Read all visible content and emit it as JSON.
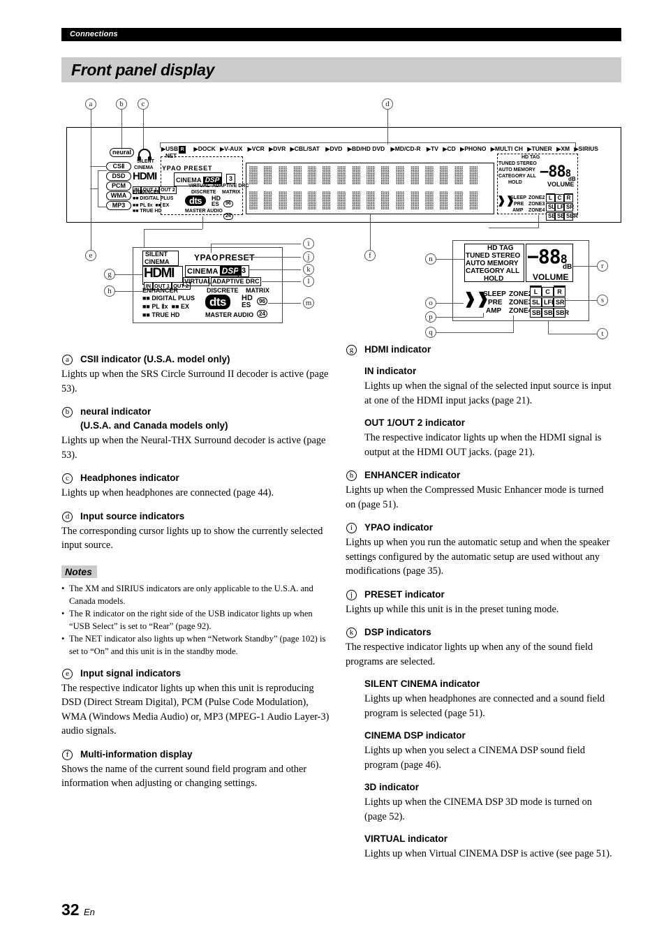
{
  "header": {
    "section": "Connections",
    "title": "Front panel display"
  },
  "footer": {
    "page_number": "32",
    "lang": "En"
  },
  "diagram": {
    "callouts_top": [
      "a",
      "b",
      "c",
      "d"
    ],
    "callouts_left": [
      "e",
      "g",
      "h"
    ],
    "callouts_mid": [
      "f"
    ],
    "callouts_detail_left": [
      "i",
      "j",
      "k",
      "l",
      "m"
    ],
    "callouts_detail_right": [
      "n",
      "o",
      "p",
      "q",
      "r",
      "s",
      "t"
    ],
    "neural_label": "neural",
    "signal_labels": [
      "CSⅡ",
      "DSD",
      "PCM",
      "WMA",
      "MP3"
    ],
    "input_sources_row1": [
      "USB",
      "DOCK",
      "V-AUX",
      "VCR",
      "DVR",
      "CBL/SAT",
      "DVD",
      "BD/HD DVD",
      "MD/CD-R",
      "TV",
      "CD",
      "PHONO",
      "MULTI CH",
      "TUNER",
      "XM",
      "SIRIUS"
    ],
    "usb_rear_badge": "R",
    "net_label": "NET",
    "silent": "SILENT",
    "cinema": "CINEMA",
    "hdmi": "HDMI",
    "hdmi_in": "IN",
    "hdmi_out1": "OUT 1",
    "hdmi_out2": "OUT 2",
    "ypao": "YPAO",
    "preset": "PRESET",
    "preset_num": "3",
    "cinema_dsp_a": "CINEMA",
    "cinema_dsp_b": "DSP",
    "dsp_3d": "3",
    "virtual": "VIRTUAL",
    "adaptive_drc": "ADAPTIVE DRC",
    "enhancer": "ENHANCER",
    "discrete": "DISCRETE",
    "matrix": "MATRIX",
    "dd_digital_plus": "DIGITAL PLUS",
    "dd_pllx": "PL Ⅱx",
    "dd_ex": "EX",
    "dd_true_hd": "TRUE HD",
    "dts": "dts",
    "master_audio": "MASTER AUDIO",
    "hd_es": "HD",
    "es": "ES",
    "num_96": "96",
    "num_24": "24",
    "tuner_block": [
      "HD  TAG",
      "TUNED STEREO",
      "AUTO MEMORY",
      "CATEGORY ALL",
      "HOLD"
    ],
    "volume_minus": "−",
    "volume_digits": "88",
    "volume_decimal": "8",
    "volume_db": "dB",
    "volume_label": "VOLUME",
    "sleep": "SLEEP",
    "pre": "PRE",
    "amp": "AMP",
    "zone2": "ZONE2",
    "zone3": "ZONE3",
    "zone4": "ZONE4",
    "speakers_row1": [
      "L",
      "C",
      "R"
    ],
    "speakers_row2": [
      "SL",
      "LFE",
      "SR"
    ],
    "speakers_row3": [
      "SBL",
      "SB",
      "SBR"
    ]
  },
  "left_column": [
    {
      "mark": "a",
      "heading": "CSII indicator (U.S.A. model only)",
      "paras": [
        "Lights up when the SRS Circle Surround II decoder is active (page 53)."
      ]
    },
    {
      "mark": "b",
      "heading": "neural indicator",
      "heading2": "(U.S.A. and Canada models only)",
      "paras": [
        "Lights up when the Neural-THX Surround decoder is active (page 53)."
      ]
    },
    {
      "mark": "c",
      "heading": "Headphones indicator",
      "paras": [
        "Lights up when headphones are connected (page 44)."
      ]
    },
    {
      "mark": "d",
      "heading": "Input source indicators",
      "paras": [
        "The corresponding cursor lights up to show the currently selected input source."
      ]
    }
  ],
  "notes": {
    "label": "Notes",
    "items": [
      "The XM and SIRIUS indicators are only applicable to the U.S.A. and Canada models.",
      "The R indicator on the right side of the USB indicator lights up when “USB Select” is set to “Rear” (page 92).",
      "The NET indicator also lights up when “Network Standby” (page 102) is set to “On” and this unit is in the standby mode."
    ]
  },
  "left_column_after_notes": [
    {
      "mark": "e",
      "heading": "Input signal indicators",
      "paras": [
        "The respective indicator lights up when this unit is reproducing DSD (Direct Stream Digital), PCM (Pulse Code Modulation), WMA (Windows Media Audio) or, MP3 (MPEG-1 Audio Layer-3) audio signals."
      ]
    },
    {
      "mark": "f",
      "heading": "Multi-information display",
      "paras": [
        "Shows the name of the current sound field program and other information when adjusting or changing settings."
      ]
    }
  ],
  "right_column": [
    {
      "mark": "g",
      "heading": "HDMI indicator",
      "subs": [
        {
          "heading": "IN indicator",
          "paras": [
            "Lights up when the signal of the selected input source is input at one of the HDMI input jacks (page 21)."
          ]
        },
        {
          "heading": "OUT 1/OUT 2 indicator",
          "paras": [
            "The respective indicator lights up when the HDMI signal is output at the HDMI OUT jacks. (page 21)."
          ]
        }
      ]
    },
    {
      "mark": "h",
      "heading": "ENHANCER indicator",
      "paras": [
        "Lights up when the Compressed Music Enhancer mode is turned on (page 51)."
      ]
    },
    {
      "mark": "i",
      "heading": "YPAO indicator",
      "paras": [
        "Lights up when you run the automatic setup and when the speaker settings configured by the automatic setup are used without any modifications (page 35)."
      ]
    },
    {
      "mark": "j",
      "heading": "PRESET indicator",
      "paras": [
        "Lights up while this unit is in the preset tuning mode."
      ]
    },
    {
      "mark": "k",
      "heading": "DSP indicators",
      "paras": [
        "The respective indicator lights up when any of the sound field programs are selected."
      ],
      "subs": [
        {
          "heading": "SILENT CINEMA indicator",
          "paras": [
            "Lights up when headphones are connected and a sound field program is selected (page 51)."
          ]
        },
        {
          "heading": "CINEMA DSP indicator",
          "paras": [
            "Lights up when you select a CINEMA DSP sound field program (page 46)."
          ]
        },
        {
          "heading": "3D indicator",
          "paras": [
            "Lights up when the CINEMA DSP 3D mode is turned on (page 52)."
          ]
        },
        {
          "heading": "VIRTUAL indicator",
          "paras": [
            "Lights up when Virtual CINEMA DSP is active (see page 51)."
          ]
        }
      ]
    }
  ]
}
